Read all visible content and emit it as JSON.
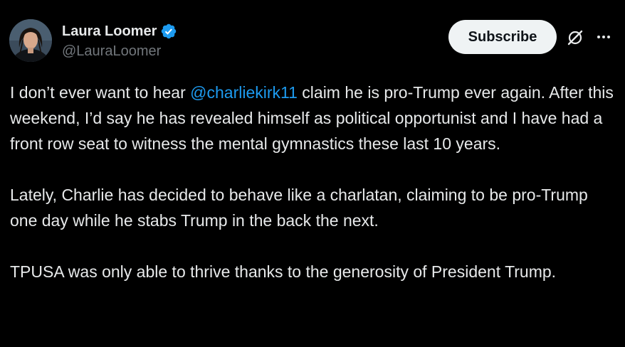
{
  "author": {
    "display_name": "Laura Loomer",
    "handle": "@LauraLoomer",
    "verified_icon": "verified-badge-icon",
    "verified_color": "#1d9bf0"
  },
  "actions": {
    "subscribe_label": "Subscribe",
    "grok_icon": "grok-icon",
    "more_icon": "more-options-icon"
  },
  "tweet": {
    "p1_before": "I don’t ever want to hear ",
    "p1_mention": "@charliekirk11",
    "p1_after": " claim he is pro-Trump ever again. After this weekend, I’d say he has revealed himself as political opportunist and I have had a front row seat to witness the mental gymnastics these last 10 years.",
    "p2": "Lately, Charlie has decided to behave like a charlatan, claiming to be pro-Trump one day while he stabs Trump in the back the next.",
    "p3": "TPUSA was only able to thrive thanks to the generosity of President Trump."
  },
  "colors": {
    "background": "#000000",
    "text": "#e7e9ea",
    "secondary_text": "#71767b",
    "link": "#1d9bf0",
    "button_bg": "#eff3f4"
  }
}
